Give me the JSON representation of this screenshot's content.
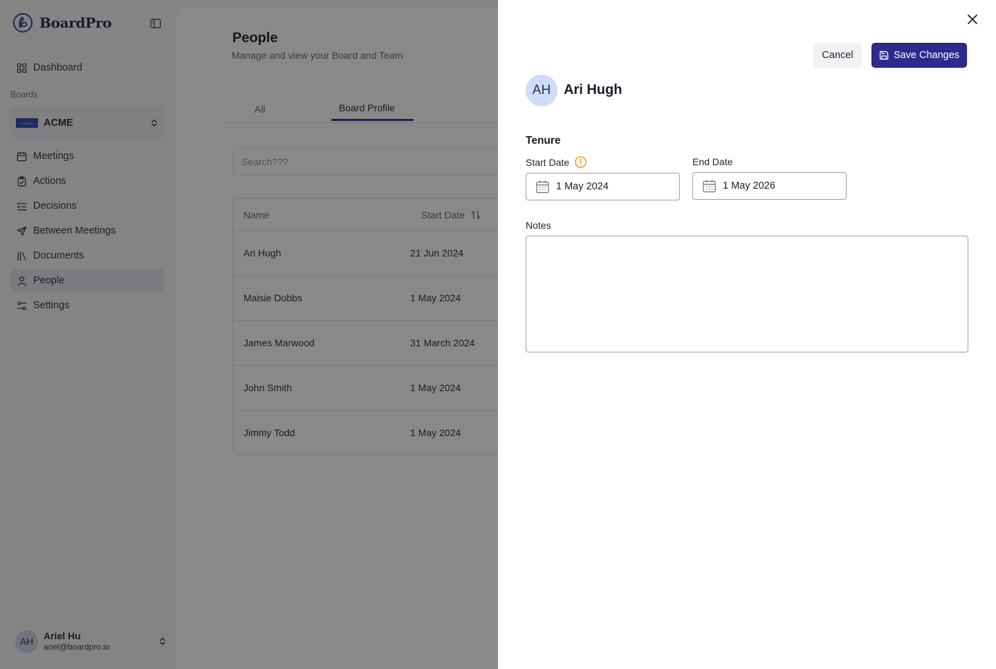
{
  "app": {
    "brand": "BoardPro",
    "nav_main": [
      {
        "label": "Dashboard",
        "icon": "grid-icon"
      }
    ],
    "boards_label": "Boards",
    "board": {
      "name": "ACME",
      "logo_text": "BoardPro"
    },
    "nav_items": [
      {
        "label": "Meetings",
        "icon": "calendar-icon"
      },
      {
        "label": "Actions",
        "icon": "clipboard-check-icon"
      },
      {
        "label": "Decisions",
        "icon": "list-check-icon"
      },
      {
        "label": "Between Meetings",
        "icon": "send-icon"
      },
      {
        "label": "Documents",
        "icon": "library-icon"
      },
      {
        "label": "People",
        "icon": "user-icon"
      },
      {
        "label": "Settings",
        "icon": "sliders-icon"
      }
    ],
    "user": {
      "initials": "AH",
      "name": "Ariel Hu",
      "email": "ariel@boardpro.io"
    }
  },
  "page": {
    "title": "People",
    "subtitle": "Manage and view your Board and Team",
    "tabs": [
      {
        "label": "All"
      },
      {
        "label": "Board Profile",
        "active": true
      }
    ],
    "search_placeholder": "Search???",
    "table": {
      "columns": [
        "Name",
        "Start Date"
      ],
      "rows": [
        {
          "name": "Ari Hugh",
          "start": "21 Jun 2024"
        },
        {
          "name": "Maisie Dobbs",
          "start": "1 May 2024"
        },
        {
          "name": "James Marwood",
          "start": "31 March 2024"
        },
        {
          "name": "John Smith",
          "start": "1 May 2024"
        },
        {
          "name": "Jimmy Todd",
          "start": "1 May 2024"
        }
      ]
    }
  },
  "drawer": {
    "cancel_label": "Cancel",
    "save_label": "Save Changes",
    "person": {
      "initials": "AH",
      "name": "Ari Hugh"
    },
    "tenure_title": "Tenure",
    "start_label": "Start Date",
    "start_value": "1 May 2024",
    "end_label": "End Date",
    "end_value": "1 May 2026",
    "notes_label": "Notes",
    "notes_value": ""
  },
  "colors": {
    "primary": "#2e2a8c",
    "warning": "#f0a020",
    "avatar_bg": "#cfdcf8"
  }
}
